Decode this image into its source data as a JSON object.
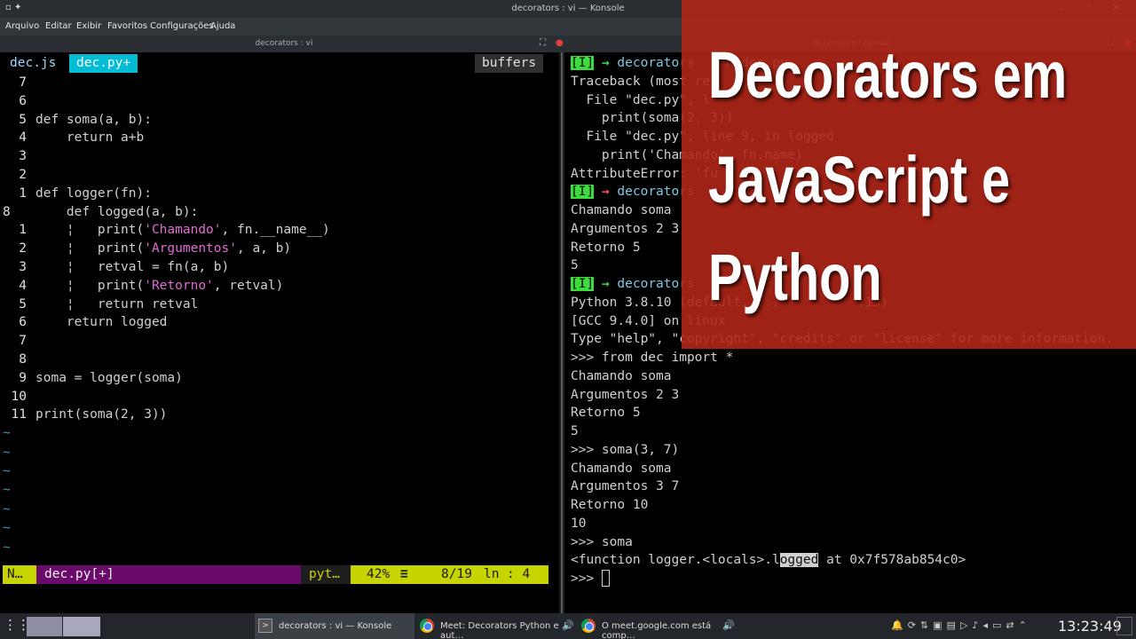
{
  "window": {
    "title": "decorators : vi — Konsole",
    "left_icons": "▫ ✦",
    "right_icons": "⌄ ˄ ✕"
  },
  "menu": [
    "Arquivo",
    "Editar",
    "Exibir",
    "Favoritos",
    "Configurações",
    "Ajuda"
  ],
  "left_pane": {
    "title": "decorators : vi",
    "tabs": [
      {
        "label": "dec.js",
        "active": false
      },
      {
        "label": "dec.py+",
        "active": true
      }
    ],
    "buffers_label": "buffers",
    "code_lines": [
      {
        "n": "7",
        "t": ""
      },
      {
        "n": "6",
        "t": ""
      },
      {
        "n": "5",
        "t": "def soma(a, b):"
      },
      {
        "n": "4",
        "t": "    return a+b"
      },
      {
        "n": "3",
        "t": ""
      },
      {
        "n": "2",
        "t": ""
      },
      {
        "n": "1",
        "t": "def logger(fn):"
      },
      {
        "n": "8",
        "t": "    def logged(a, b):"
      },
      {
        "n": "1",
        "t": "    ¦   print('Chamando', fn.__name__)"
      },
      {
        "n": "2",
        "t": "    ¦   print('Argumentos', a, b)"
      },
      {
        "n": "3",
        "t": "    ¦   retval = fn(a, b)"
      },
      {
        "n": "4",
        "t": "    ¦   print('Retorno', retval)"
      },
      {
        "n": "5",
        "t": "    ¦   return retval"
      },
      {
        "n": "6",
        "t": "    return logged"
      },
      {
        "n": "7",
        "t": ""
      },
      {
        "n": "8",
        "t": ""
      },
      {
        "n": "9",
        "t": "soma = logger(soma)"
      },
      {
        "n": "10",
        "t": ""
      },
      {
        "n": "11",
        "t": "print(soma(2, 3))"
      }
    ],
    "tilde": "~",
    "status": {
      "mode": "N…",
      "file": "dec.py[+]",
      "filetype": "pyt…",
      "percent": "42%",
      "menu_glyph": "≡",
      "position": "8/19",
      "ln_label": "ln",
      "col": ":  4"
    }
  },
  "right_pane": {
    "title": "decorators : python",
    "lines": [
      "[I] → decorators    n dec.py",
      "Traceback (most re",
      "  File \"dec.py\", l",
      "    print(soma(2, 3))",
      "  File \"dec.py\", line 9, in logged",
      "    print('Chamando', fn.name)",
      "AttributeError: 'fu",
      "[I] → decorators",
      "Chamando soma",
      "Argumentos 2 3",
      "Retorno 5",
      "5",
      "[I] → decorators",
      "Python 3.8.10 (default, ...          :15)",
      "[GCC 9.4.0] on linux",
      "Type \"help\", \"copyright\", \"credits\" or \"license\" for more information.",
      ">>> from dec import *",
      "Chamando soma",
      "Argumentos 2 3",
      "Retorno 5",
      "5",
      ">>> soma(3, 7)",
      "Chamando soma",
      "Argumentos 3 7",
      "Retorno 10",
      "10",
      ">>> soma",
      "<function logger.<locals>.logged at 0x7f578ab854c0>",
      ">>> "
    ]
  },
  "banner": {
    "lines": [
      "Decorators em",
      "JavaScript e",
      "Python"
    ]
  },
  "taskbar": {
    "items": [
      {
        "label": "decorators : vi — Konsole"
      },
      {
        "label": "Meet: Decorators Python e aut…"
      },
      {
        "label": "O meet.google.com está comp…"
      }
    ],
    "clock": "13:23:49"
  },
  "colors": {
    "tab_active": "#00bcd4",
    "status_mode": "#c8d400",
    "status_file": "#6a0a6a",
    "banner": "#b02618",
    "prompt_green": "#3ddc3d",
    "arrow_red": "#ff5050"
  }
}
